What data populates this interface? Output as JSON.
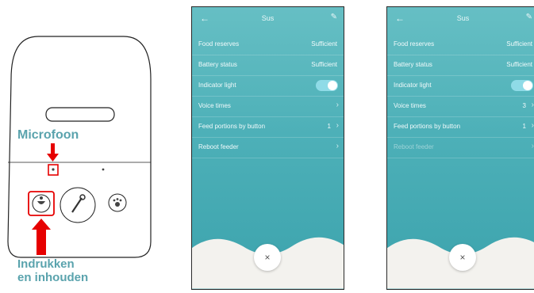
{
  "device": {
    "microphone_label": "Microfoon",
    "press_hold_label_line1": "Indrukken",
    "press_hold_label_line2": "en inhouden",
    "colors": {
      "callout": "#5aa3ad",
      "arrow": "#e60000",
      "highlight": "#e60000"
    },
    "icons": {
      "mic": "microphone-hole-icon",
      "left_button": "bowl-button-icon",
      "center_button": "key-button-icon",
      "right_button": "paw-button-icon"
    }
  },
  "phones": [
    {
      "header": {
        "back_icon": "←",
        "title": "Sus",
        "edit_icon": "✎"
      },
      "rows": [
        {
          "label": "Food reserves",
          "value": "Sufficient"
        },
        {
          "label": "Battery status",
          "value": "Sufficient"
        },
        {
          "label": "Indicator light",
          "toggle": true
        },
        {
          "label": "Voice times",
          "chevron": "›"
        },
        {
          "label": "Feed portions by button",
          "value": "1",
          "chevron": "›"
        },
        {
          "label": "Reboot feeder",
          "chevron": "›"
        }
      ],
      "close_icon": "×"
    },
    {
      "header": {
        "back_icon": "←",
        "title": "Sus",
        "edit_icon": "✎"
      },
      "rows": [
        {
          "label": "Food reserves",
          "value": "Sufficient"
        },
        {
          "label": "Battery status",
          "value": "Sufficient"
        },
        {
          "label": "Indicator light",
          "toggle": true
        },
        {
          "label": "Voice times",
          "value": "3",
          "chevron": "›"
        },
        {
          "label": "Feed portions by button",
          "value": "1",
          "chevron": "›"
        },
        {
          "label": "Reboot feeder",
          "chevron": "›",
          "disabled": true
        }
      ],
      "close_icon": "×"
    }
  ],
  "colors": {
    "screen_top": "#66bfc4",
    "screen_bottom": "#3ca3ad",
    "toggle_on": "#8fdbe7",
    "bottom_wave": "#f3f2ee"
  }
}
